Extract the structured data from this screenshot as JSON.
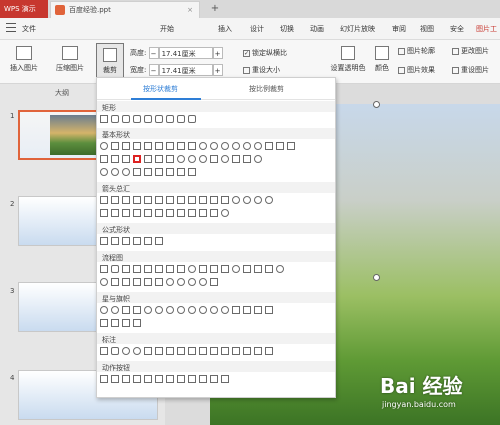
{
  "window": {
    "app_tab": "WPS 演示",
    "doc_tab": "百度经验.ppt",
    "new_tab": "+"
  },
  "menu": {
    "file": "文件",
    "items": [
      "开始",
      "插入",
      "设计",
      "切换",
      "动画",
      "幻灯片放映",
      "审阅",
      "视图",
      "安全",
      "图片工具"
    ],
    "active_index": 9
  },
  "ribbon": {
    "insert_picture": "插入图片",
    "compress_picture": "压缩图片",
    "crop": "裁剪",
    "height_label": "高度:",
    "height_value": "17.41厘米",
    "width_label": "宽度:",
    "width_value": "17.41厘米",
    "lock_ratio": "锁定纵横比",
    "reset_size": "重设大小",
    "set_transparent": "设置透明色",
    "color": "颜色",
    "picture_outline": "图片轮廓",
    "picture_effect": "图片效果",
    "change_picture": "更改图片",
    "reset_picture": "重设图片",
    "minus": "−",
    "plus": "+"
  },
  "left_pane": {
    "tab_outline": "大纲",
    "slide_numbers": [
      "1",
      "2",
      "3",
      "4"
    ]
  },
  "dropdown": {
    "tab_shape_crop": "按形状裁剪",
    "tab_ratio_crop": "按比例裁剪",
    "sections": [
      "矩形",
      "基本形状",
      "箭头总汇",
      "公式形状",
      "流程图",
      "星与旗帜",
      "标注",
      "动作按钮"
    ]
  },
  "watermark": {
    "logo": "Bai 经验",
    "url": "jingyan.baidu.com"
  },
  "colors": {
    "accent": "#c7372f",
    "tab_active": "#2e7ed6",
    "selected_shape": "#d22222"
  }
}
